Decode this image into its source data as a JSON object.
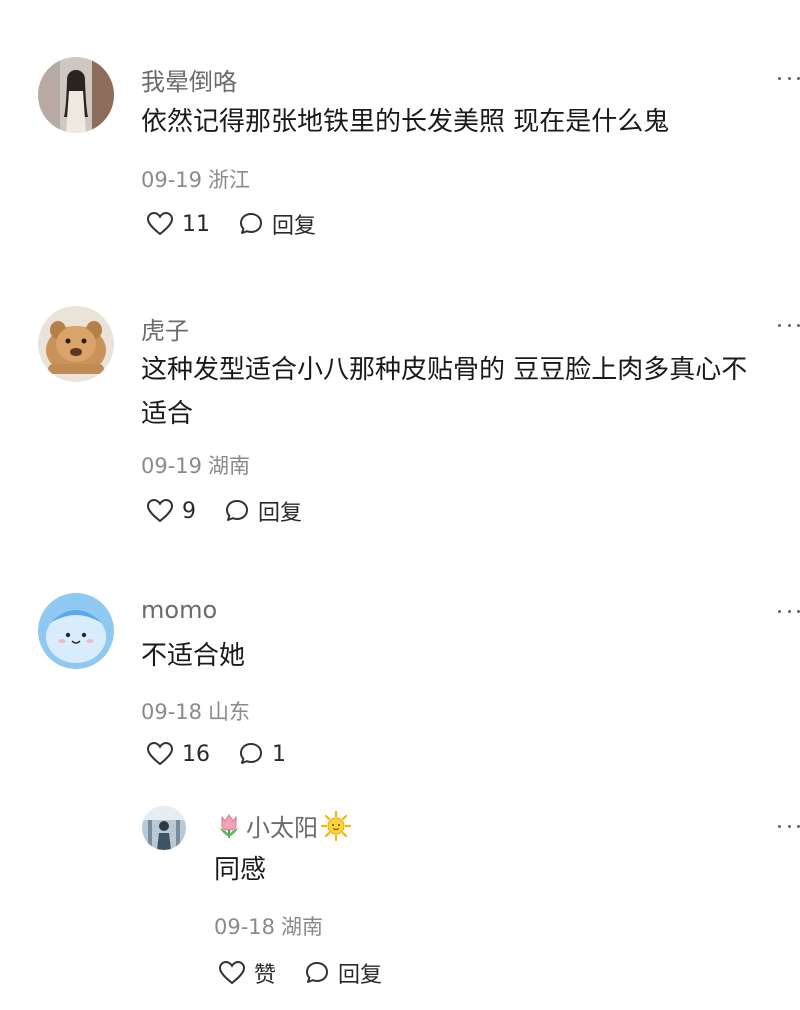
{
  "comments": [
    {
      "username": "我晕倒咯",
      "content": "依然记得那张地铁里的长发美照 现在是什么鬼",
      "date": "09-19",
      "location": "浙江",
      "likes": "11",
      "reply_label": "回复",
      "avatar_icon": "avatar-photo-woman-icon"
    },
    {
      "username": "虎子",
      "content_line1": "这种发型适合小八那种皮贴骨的 豆豆脸上肉多真心不",
      "content_line2": "适合",
      "date": "09-19",
      "location": "湖南",
      "likes": "9",
      "reply_label": "回复",
      "avatar_icon": "avatar-lion-cub-icon"
    },
    {
      "username": "momo",
      "content": "不适合她",
      "date": "09-18",
      "location": "山东",
      "likes": "16",
      "replies": "1",
      "avatar_icon": "avatar-blue-cartoon-icon"
    }
  ],
  "reply": {
    "username": "小太阳",
    "content": "同感",
    "date": "09-18",
    "location": "湖南",
    "like_label": "赞",
    "reply_label": "回复",
    "avatar_icon": "avatar-photo-icon",
    "prefix_emoji": "tulip-icon",
    "suffix_emoji": "sun-icon"
  },
  "colors": {
    "username": "#6b6b6b",
    "meta": "#8a8a8a",
    "text": "#1a1a1a"
  }
}
